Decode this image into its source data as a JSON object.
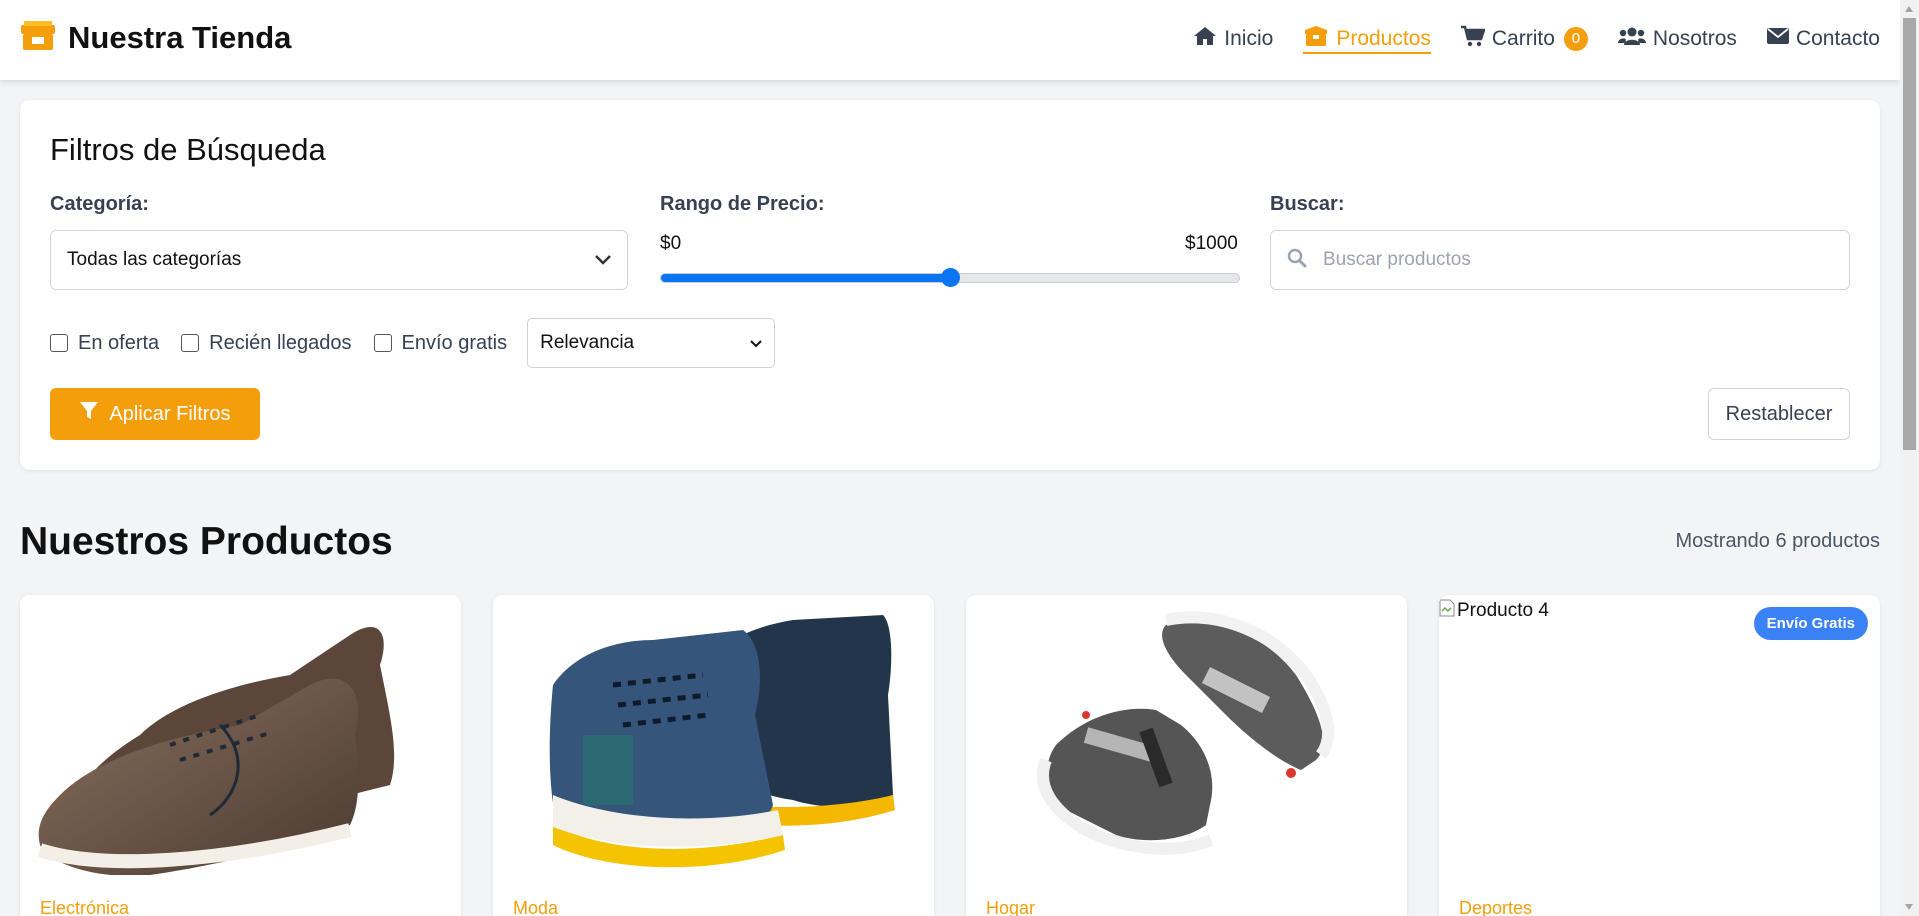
{
  "header": {
    "title": "Nuestra Tienda",
    "nav": [
      {
        "label": "Inicio",
        "icon": "home-icon"
      },
      {
        "label": "Productos",
        "icon": "box-icon",
        "active": true
      },
      {
        "label": "Carrito",
        "icon": "cart-icon",
        "count": "0"
      },
      {
        "label": "Nosotros",
        "icon": "users-icon"
      },
      {
        "label": "Contacto",
        "icon": "envelope-icon"
      }
    ]
  },
  "filters": {
    "title": "Filtros de Búsqueda",
    "category_label": "Categoría:",
    "category_value": "Todas las categorías",
    "price_label": "Rango de Precio:",
    "price_min": "$0",
    "price_max": "$1000",
    "price_level": 0.5,
    "search_label": "Buscar:",
    "search_placeholder": "Buscar productos",
    "checkboxes": [
      "En oferta",
      "Recién llegados",
      "Envío gratis"
    ],
    "sort_value": "Relevancia",
    "apply_label": "Aplicar Filtros",
    "reset_label": "Restablecer"
  },
  "products": {
    "title": "Nuestros Productos",
    "count_text": "Mostrando 6 productos",
    "items": [
      {
        "category": "Electrónica"
      },
      {
        "category": "Moda"
      },
      {
        "category": "Hogar"
      },
      {
        "category": "Deportes",
        "alt": "Producto 4",
        "badge": "Envío Gratis"
      }
    ]
  },
  "colors": {
    "accent": "#f59e0b",
    "slider": "#0b74f2",
    "badge_blue": "#3b82f6"
  }
}
